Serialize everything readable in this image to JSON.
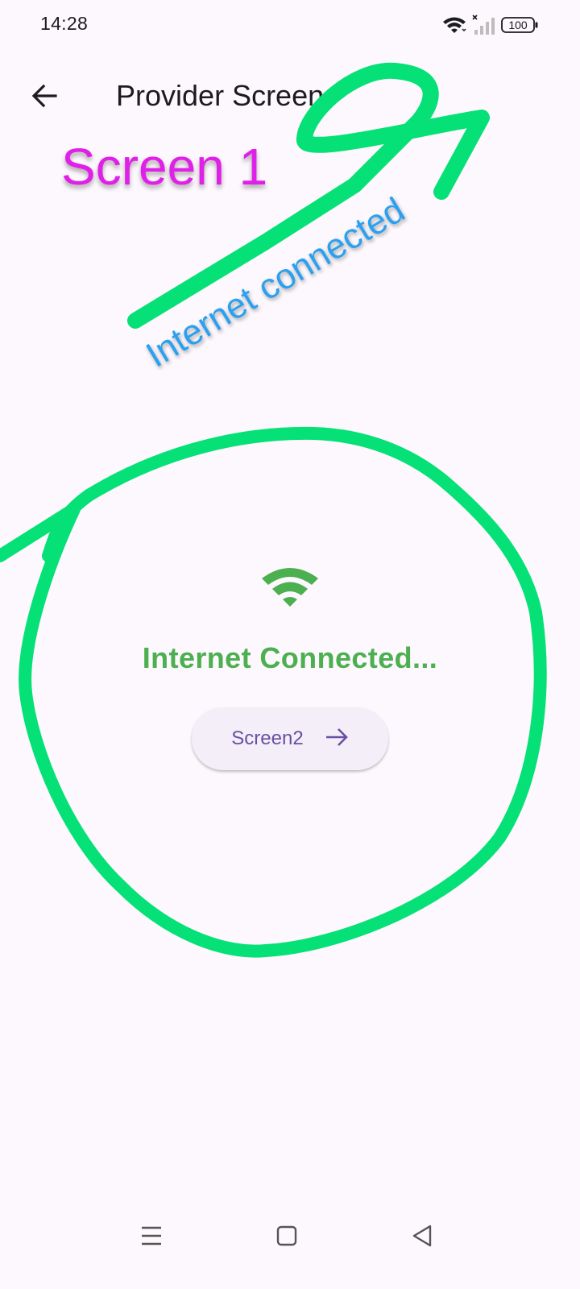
{
  "status_bar": {
    "time": "14:28",
    "battery": "100",
    "icons": [
      "wifi-icon",
      "cellular-no-signal-icon",
      "battery-icon"
    ]
  },
  "app_bar": {
    "title": "Provider Screen",
    "back_icon": "arrow-back-icon"
  },
  "main": {
    "status_icon": "wifi-icon",
    "status_text": "Internet Connected...",
    "status_color": "#4caf50",
    "button_label": "Screen2",
    "button_icon": "arrow-forward-icon"
  },
  "annotations": {
    "screen_label": "Screen 1",
    "connected_label": "Internet connected",
    "marker_color": "#05e176"
  },
  "nav_bar": {
    "icons": [
      "menu-icon",
      "home-icon",
      "back-triangle-icon"
    ]
  }
}
